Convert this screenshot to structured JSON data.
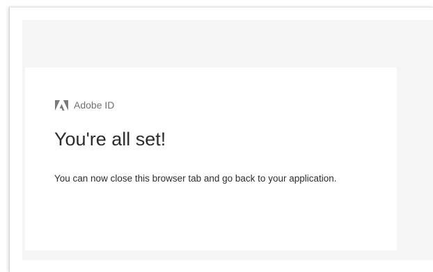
{
  "brand": {
    "logo_icon": "adobe-logo-icon",
    "name": "Adobe ID"
  },
  "main": {
    "title": "You're all set!",
    "message": "You can now close this browser tab and go back to your application."
  }
}
